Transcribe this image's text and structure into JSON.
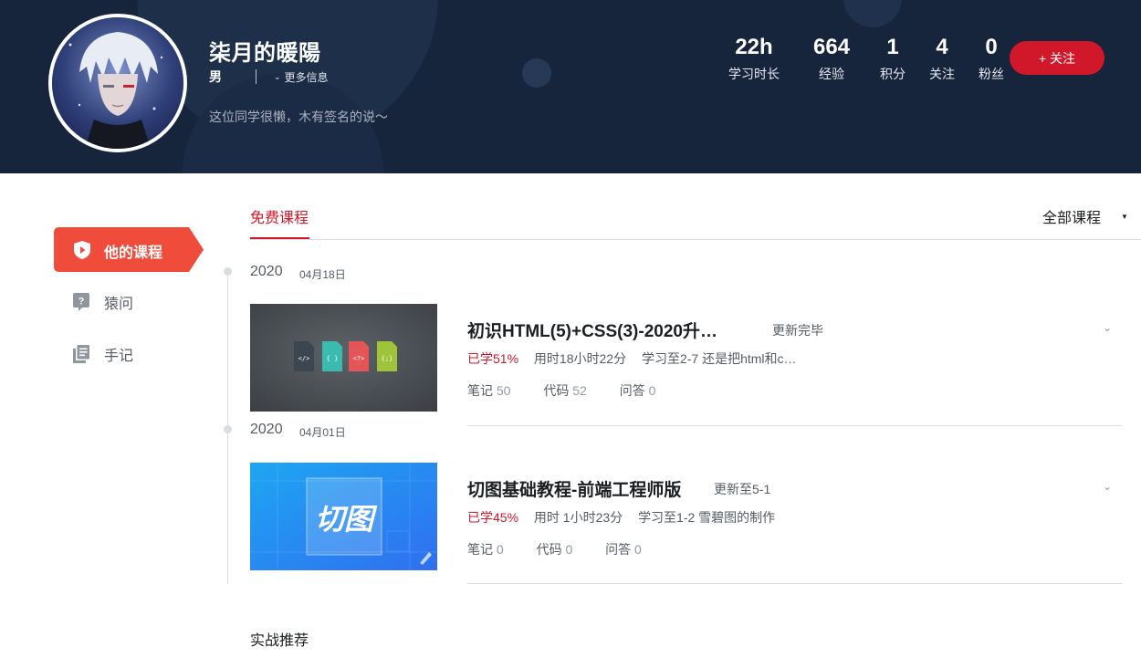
{
  "profile": {
    "name": "柒月的暖陽",
    "gender": "男",
    "more_info": "更多信息",
    "signature": "这位同学很懒，木有签名的说～"
  },
  "stats": [
    {
      "value": "22h",
      "label": "学习时长"
    },
    {
      "value": "664",
      "label": "经验"
    },
    {
      "value": "1",
      "label": "积分"
    },
    {
      "value": "4",
      "label": "关注"
    },
    {
      "value": "0",
      "label": "粉丝"
    }
  ],
  "follow_button": "+ 关注",
  "sidebar": {
    "items": [
      {
        "label": "他的课程",
        "icon": "shield-icon",
        "active": true
      },
      {
        "label": "猿问",
        "icon": "question-icon",
        "active": false
      },
      {
        "label": "手记",
        "icon": "notebook-icon",
        "active": false
      }
    ]
  },
  "tabs": {
    "active": "免费课程",
    "filter": "全部课程"
  },
  "courses": [
    {
      "year": "2020",
      "date": "04月18日",
      "title": "初识HTML(5)+CSS(3)-2020升…",
      "status": "更新完毕",
      "progress": "已学51%",
      "time_spent": "用时18小时22分",
      "last_lesson": "学习至2-7 还是把html和c…",
      "notes_label": "笔记",
      "notes_count": "50",
      "code_label": "代码",
      "code_count": "52",
      "qa_label": "问答",
      "qa_count": "0",
      "thumb_icons": [
        "</>",
        "{ }",
        "<?>",
        "{;}"
      ]
    },
    {
      "year": "2020",
      "date": "04月01日",
      "title": "切图基础教程-前端工程师版",
      "status": "更新至5-1",
      "progress": "已学45%",
      "time_spent": "用时 1小时23分",
      "last_lesson": "学习至1-2 雪碧图的制作",
      "notes_label": "笔记",
      "notes_count": "0",
      "code_label": "代码",
      "code_count": "0",
      "qa_label": "问答",
      "qa_count": "0",
      "thumb_text": "切图"
    }
  ],
  "recommend_title": "实战推荐",
  "colors": {
    "banner": "#16243c",
    "accent": "#d1172a",
    "text_secondary": "#545c63"
  }
}
